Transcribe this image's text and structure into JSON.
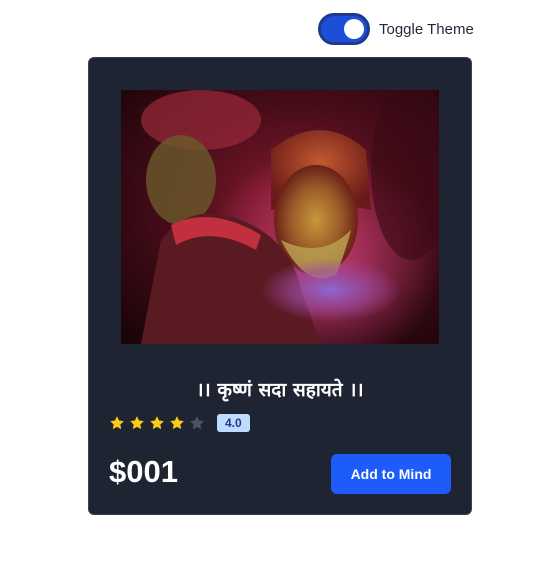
{
  "theme_toggle": {
    "label": "Toggle Theme",
    "checked": true,
    "on_color": "#1d4ed8"
  },
  "product": {
    "image_icon": "photo-image",
    "title": "।। कृष्णं सदा सहायते ।।",
    "rating": {
      "value": 4.0,
      "label": "4.0",
      "max": 5,
      "filled_color": "#facc15",
      "empty_color": "#4b5563"
    },
    "price": "$001",
    "add_button_label": "Add to Mind",
    "button_color": "#1d5cfb",
    "card_color": "#1f2433"
  }
}
